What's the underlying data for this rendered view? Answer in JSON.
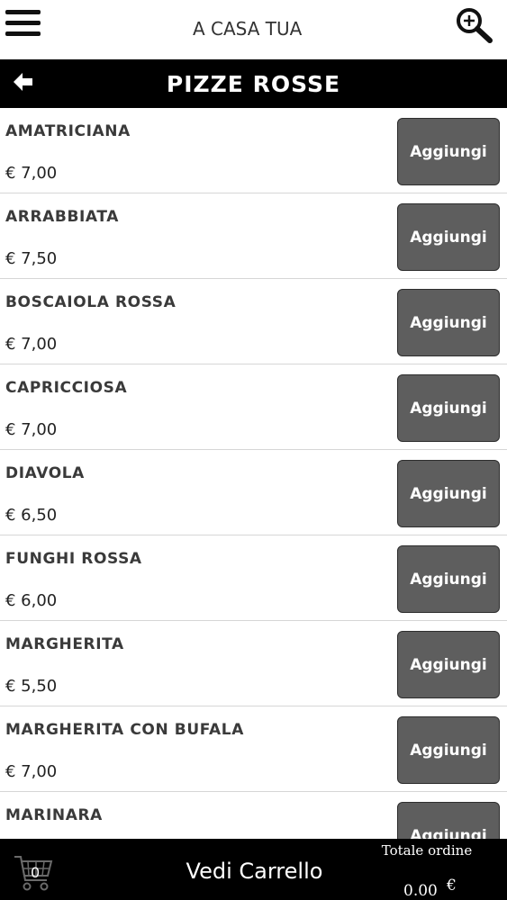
{
  "header": {
    "logo_text": "A CASA TUA",
    "menu_icon": "hamburger-menu-icon",
    "search_icon": "zoom-in-search-icon"
  },
  "title_bar": {
    "back_icon": "arrow-left-icon",
    "title": "PIZZE ROSSE"
  },
  "products": [
    {
      "name": "AMATRICIANA",
      "price": "€ 7,00",
      "button": "Aggiungi"
    },
    {
      "name": "ARRABBIATA",
      "price": "€ 7,50",
      "button": "Aggiungi"
    },
    {
      "name": "BOSCAIOLA ROSSA",
      "price": "€ 7,00",
      "button": "Aggiungi"
    },
    {
      "name": "CAPRICCIOSA",
      "price": "€ 7,00",
      "button": "Aggiungi"
    },
    {
      "name": "DIAVOLA",
      "price": "€ 6,50",
      "button": "Aggiungi"
    },
    {
      "name": "FUNGHI ROSSA",
      "price": "€ 6,00",
      "button": "Aggiungi"
    },
    {
      "name": "MARGHERITA",
      "price": "€ 5,50",
      "button": "Aggiungi"
    },
    {
      "name": "MARGHERITA CON BUFALA",
      "price": "€ 7,00",
      "button": "Aggiungi"
    },
    {
      "name": "MARINARA",
      "price": "",
      "button": "Aggiungi"
    }
  ],
  "footer": {
    "cart_icon": "shopping-cart-icon",
    "cart_count": "0",
    "view_cart_label": "Vedi Carrello",
    "total_label": "Totale ordine",
    "total_value": "0.00",
    "currency": "€"
  },
  "colors": {
    "header_bar": "#000000",
    "button_bg": "#5e5e5e",
    "button_text": "#ffffff",
    "text_dark": "#3a3a3a"
  }
}
